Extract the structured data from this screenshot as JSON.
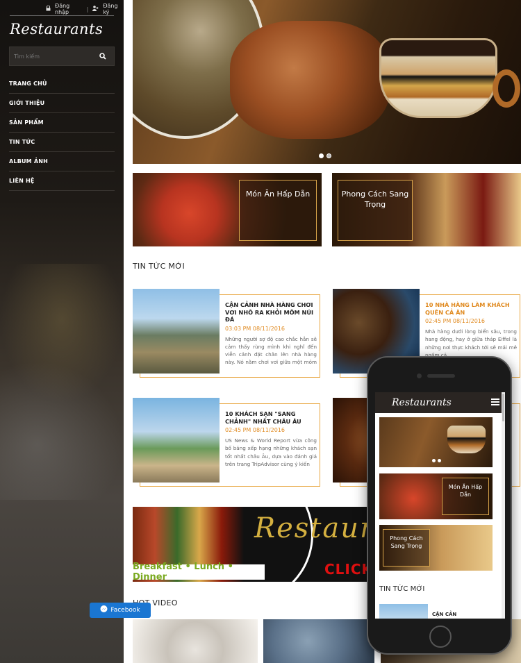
{
  "header": {
    "login_label": "Đăng nhập",
    "register_label": "Đăng ký"
  },
  "brand": {
    "logo_text": "Restaurants"
  },
  "search": {
    "placeholder": "Tìm kiếm"
  },
  "nav": {
    "items": [
      {
        "label": "TRANG CHỦ"
      },
      {
        "label": "GIỚI THIỆU"
      },
      {
        "label": "SẢN PHẨM"
      },
      {
        "label": "TIN TỨC"
      },
      {
        "label": "ALBUM ẢNH"
      },
      {
        "label": "LIÊN HỆ"
      }
    ]
  },
  "banners": [
    {
      "label": "Món Ăn Hấp Dẫn"
    },
    {
      "label": "Phong Cách Sang Trọng"
    }
  ],
  "news_section": {
    "title": "TIN TỨC MỚI"
  },
  "news": [
    {
      "title": "CẬN CẢNH NHÀ HÀNG CHƠI VƠI NHÔ RA KHỎI MÕM NÚI ĐÁ",
      "date": "03:03 PM 08/11/2016",
      "desc": "Những người sợ độ cao chắc hẳn sẽ cảm thấy rùng mình khi nghĩ đến viễn cảnh đặt chân lên nhà hàng này. Nó nằm chơi vơi giữa một mỏm đá và"
    },
    {
      "title": "10 NHÀ HÀNG LÀM KHÁCH QUÊN CẢ ĂN",
      "date": "02:45 PM 08/11/2016",
      "desc": "Nhà hàng dưới lòng biển sâu, trong hang động, hay ở giữa tháp Eiffel là những nơi thực khách tới sẽ mải mê ngắm cả"
    },
    {
      "title": "10 KHÁCH SẠN \"SANG CHẢNH\" NHẤT CHÂU ÂU",
      "date": "02:45 PM 08/11/2016",
      "desc": "US News & World Report vừa công bố bảng xếp hạng những khách sạn tốt nhất châu Âu, dựa vào đánh giá trên trang TripAdvisor cùng ý kiến"
    }
  ],
  "ad": {
    "script_text": "Restaura",
    "meals_text": "Breakfast • Lunch • Dinner",
    "cta_text": "CLICK"
  },
  "video_section": {
    "title": "HOT VIDEO"
  },
  "mobile": {
    "logo_text": "Restaurants",
    "banner1": "Món Ăn Hấp Dẫn",
    "banner2": "Phong Cách Sang Trọng",
    "news_title": "TIN TỨC MỚI",
    "news_snippet": "CẬN CẢN"
  },
  "facebook": {
    "label": "Facebook"
  },
  "colors": {
    "accent": "#e08a20",
    "frame": "#e8a640",
    "sidebar": "#1a1714"
  }
}
